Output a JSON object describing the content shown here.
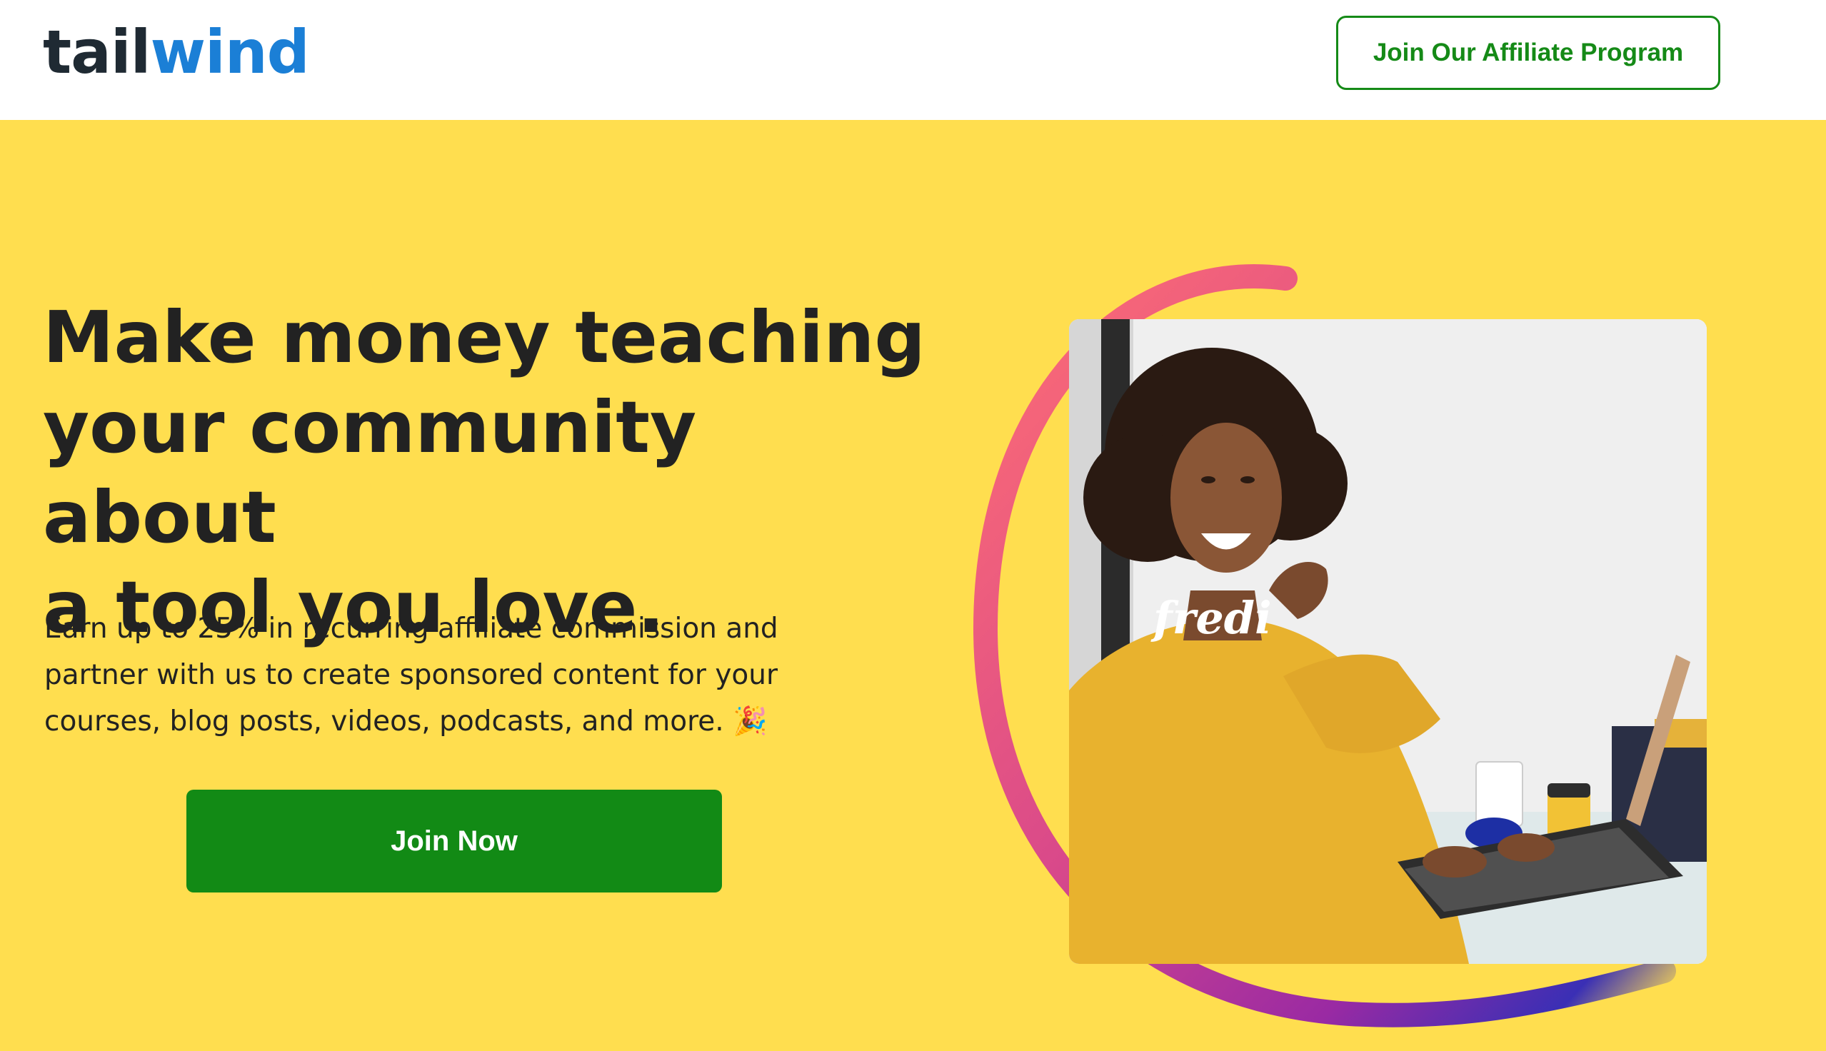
{
  "header": {
    "logo": {
      "part1": "tail",
      "part2": "wind",
      "alt": "tailwind"
    },
    "affiliate_button": "Join Our Affiliate Program"
  },
  "hero": {
    "headline_line1": "Make money teaching",
    "headline_line2": "your community about",
    "headline_line3": "a tool you love.",
    "subtext": "Earn up to 25% in recurring affiliate commission and partner with us to create sponsored content for your courses, blog posts, videos, podcasts, and more.",
    "emoji": "🎉",
    "cta_button": "Join Now",
    "photo": {
      "sweatshirt_text": "fredi"
    }
  },
  "colors": {
    "background": "#ffde4f",
    "header_bg": "#ffffff",
    "brand_dark": "#1f2a33",
    "brand_blue": "#1b7fd6",
    "green": "#128a15",
    "text": "#222222",
    "swoosh_start": "#ff6f73",
    "swoosh_mid": "#b2308e",
    "swoosh_end": "#3a2fb5"
  }
}
